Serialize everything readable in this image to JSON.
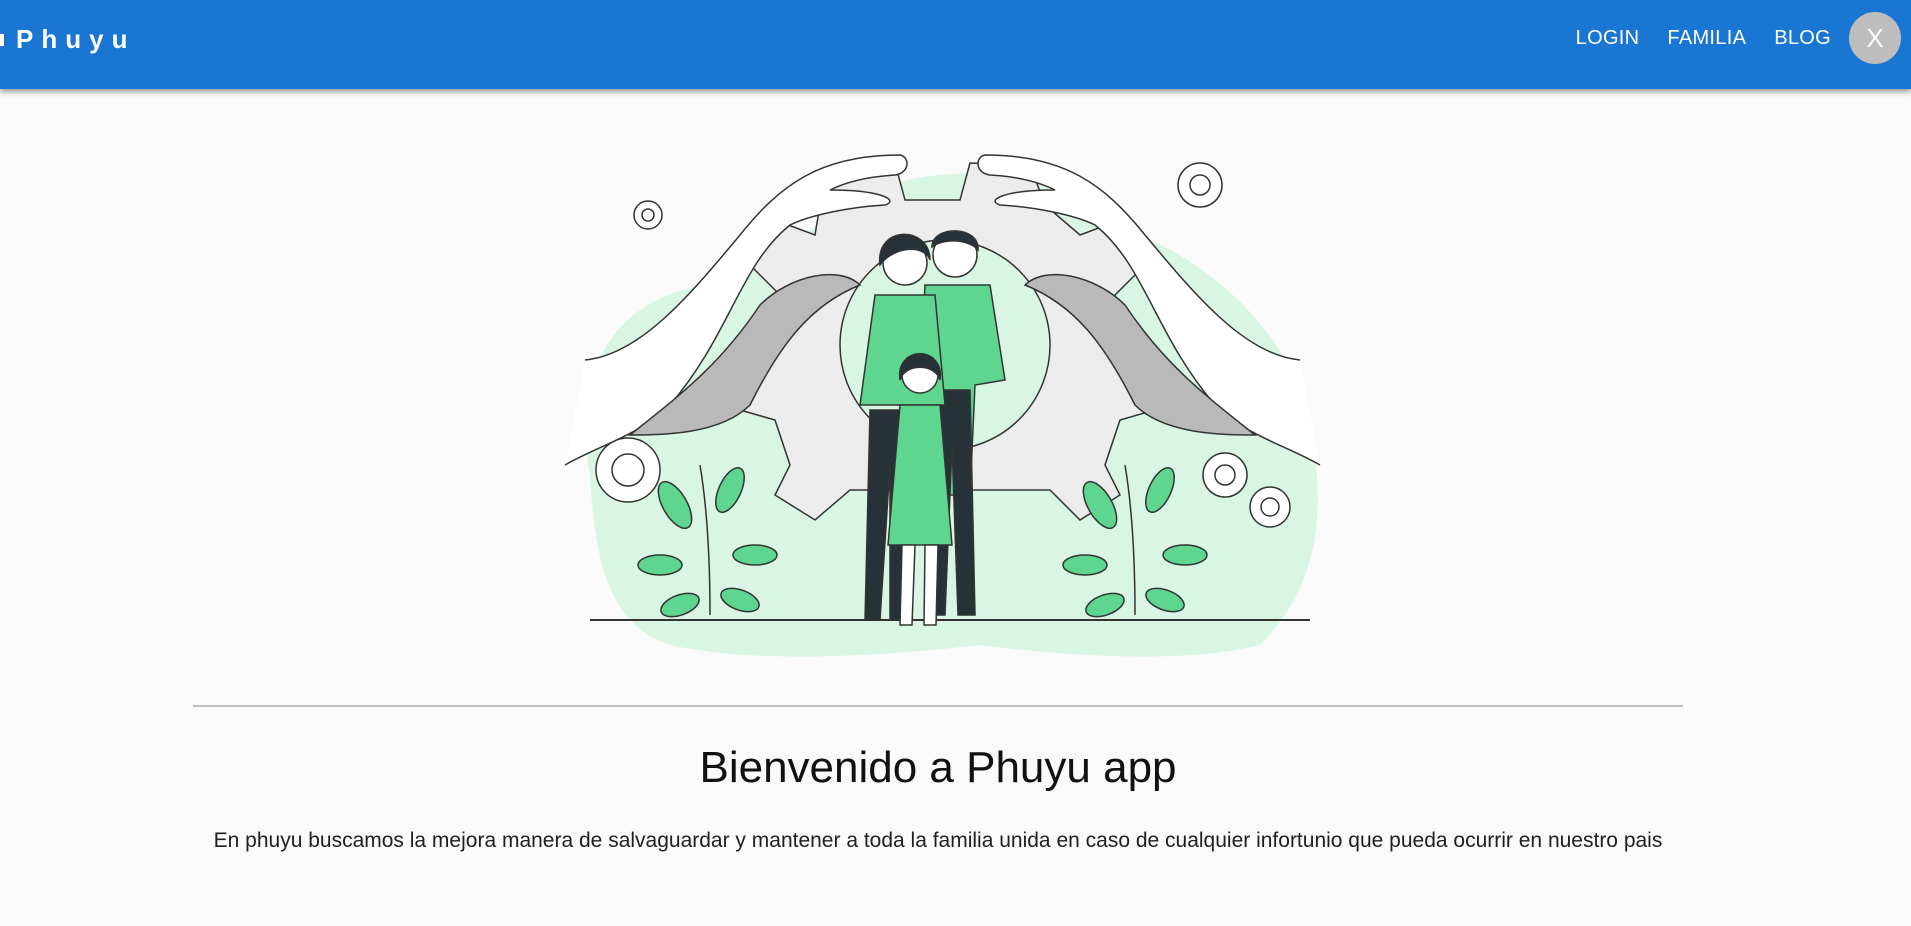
{
  "app": {
    "brand": "Phuyu"
  },
  "nav": {
    "items": [
      {
        "label": "LOGIN"
      },
      {
        "label": "FAMILIA"
      },
      {
        "label": "BLOG"
      }
    ],
    "avatar_initial": "X"
  },
  "main": {
    "title": "Bienvenido a Phuyu app",
    "description": "En phuyu buscamos la mejora manera de salvaguardar y mantener a toda la familia unida en caso de cualquier infortunio que pueda ocurrir en nuestro pais"
  },
  "colors": {
    "appbar": "#1976d2",
    "accent_green": "#5fd68f",
    "light_green": "#d8f6e3"
  }
}
